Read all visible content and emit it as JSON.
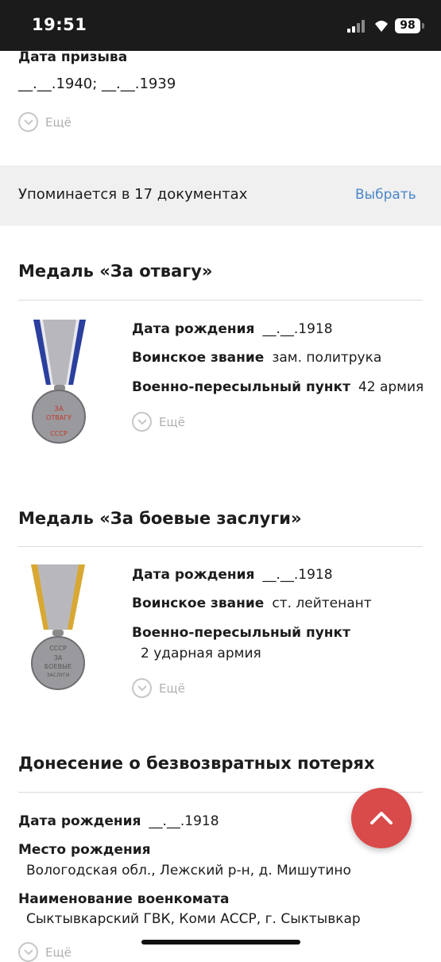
{
  "status": {
    "time": "19:51",
    "battery": "98"
  },
  "top": {
    "conscription_label": "Дата призыва",
    "conscription_value": "__.__.1940; __.__.1939",
    "more_label": "Ещё"
  },
  "mentions": {
    "text": "Упоминается в 17 документах",
    "link": "Выбрать"
  },
  "card1": {
    "title": "Медаль «За отвагу»",
    "birth_label": "Дата рождения",
    "birth_value": "__.__.1918",
    "rank_label": "Воинское звание",
    "rank_value": "зам. политрука",
    "point_label": "Военно-пересыльный пункт",
    "point_value": "42 армия",
    "more_label": "Ещё",
    "medal_text_1": "ЗА",
    "medal_text_2": "ОТВАГУ",
    "medal_text_3": "СССР"
  },
  "card2": {
    "title": "Медаль «За боевые заслуги»",
    "birth_label": "Дата рождения",
    "birth_value": "__.__.1918",
    "rank_label": "Воинское звание",
    "rank_value": "ст. лейтенант",
    "point_label": "Военно-пересыльный пункт",
    "point_value": "2 ударная армия",
    "more_label": "Ещё",
    "medal_text_1": "СССР",
    "medal_text_2": "ЗА",
    "medal_text_3": "БОЕВЫЕ",
    "medal_text_4": "ЗАСЛУГИ"
  },
  "card3": {
    "title": "Донесение о безвозвратных потерях",
    "birth_label": "Дата рождения",
    "birth_value": "__.__.1918",
    "place_label": "Место рождения",
    "place_value": "Вологодская обл., Лежский р-н, д. Мишутино",
    "office_label": "Наименование военкомата",
    "office_value": "Сыктывкарский ГВК, Коми АССР, г. Сыктывкар",
    "more_label": "Ещё"
  },
  "colors": {
    "accent_link": "#4a86c8",
    "fab": "#d94a4a",
    "status_bar": "#1b1b1b"
  }
}
